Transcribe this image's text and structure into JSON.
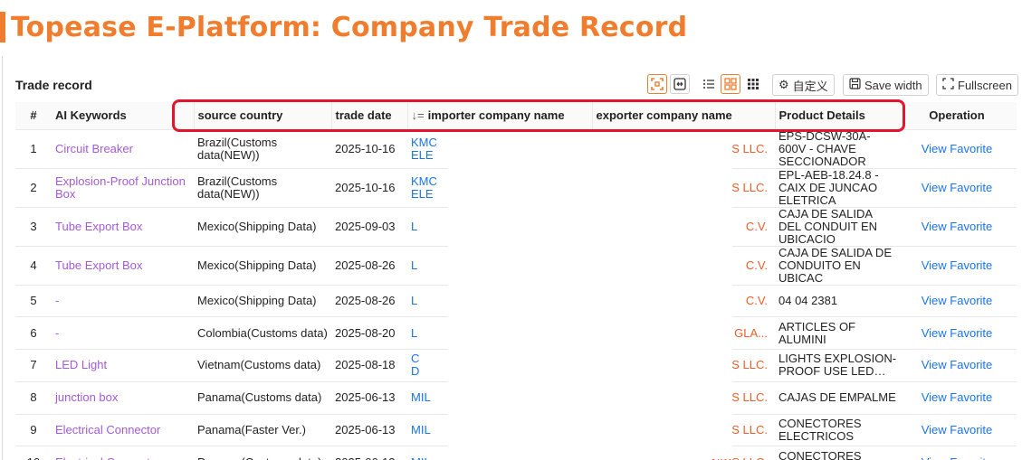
{
  "banner": {
    "title": "Topease E-Platform: Company Trade Record",
    "accent": "#ef7d2d"
  },
  "section": {
    "title": "Trade record"
  },
  "toolbar": {
    "icons": [
      "fit-screen-icon",
      "expand-width-icon",
      "list-view-icon",
      "grid-view-icon",
      "grid-dense-icon"
    ],
    "customize_label": "自定义",
    "save_width_label": "Save width",
    "fullscreen_label": "Fullscreen"
  },
  "table": {
    "headers": {
      "num": "#",
      "keywords": "AI Keywords",
      "country": "source country",
      "date": "trade date",
      "importer": "importer company name",
      "exporter": "exporter company name",
      "product": "Product Details",
      "operation": "Operation"
    },
    "rows": [
      {
        "num": "1",
        "keyword": "Circuit Breaker",
        "country": "Brazil(Customs data(NEW))",
        "date": "2025-10-16",
        "importer": "KMC",
        "importer2": "ELE",
        "exporter": "NICS LLC.",
        "product": "EPS-DCSW-30A-600V - CHAVE SECCIONADOR",
        "view": "View",
        "favorite": "Favorite"
      },
      {
        "num": "2",
        "keyword": "Explosion-Proof Junction Box",
        "country": "Brazil(Customs data(NEW))",
        "date": "2025-10-16",
        "importer": "KMC",
        "importer2": "ELE",
        "exporter": "NICS LLC.",
        "product": "EPL-AEB-18.24.8 - CAIX DE JUNCAO ELETRICA",
        "view": "View",
        "favorite": "Favorite"
      },
      {
        "num": "3",
        "keyword": "Tube Export Box",
        "country": "Mexico(Shipping Data)",
        "date": "2025-09-03",
        "importer": "L",
        "importer2": "",
        "exporter": "C.V.",
        "product": "CAJA DE SALIDA DEL CONDUIT EN UBICACIO",
        "view": "View",
        "favorite": "Favorite"
      },
      {
        "num": "4",
        "keyword": "Tube Export Box",
        "country": "Mexico(Shipping Data)",
        "date": "2025-08-26",
        "importer": "L",
        "importer2": "",
        "exporter": "C.V.",
        "product": "CAJA DE SALIDA DE CONDUITO EN UBICAC",
        "view": "View",
        "favorite": "Favorite"
      },
      {
        "num": "5",
        "keyword": "-",
        "country": "Mexico(Shipping Data)",
        "date": "2025-08-26",
        "importer": "L",
        "importer2": "",
        "exporter": "C.V.",
        "product": "04 04 2381",
        "view": "View",
        "favorite": "Favorite"
      },
      {
        "num": "6",
        "keyword": "-",
        "country": "Colombia(Customs data)",
        "date": "2025-08-20",
        "importer": "L",
        "importer2": "",
        "exporter": "ICAS GLA...",
        "product": "ARTICLES OF ALUMINI",
        "view": "View",
        "favorite": "Favorite"
      },
      {
        "num": "7",
        "keyword": "LED Light",
        "country": "Vietnam(Customs data)",
        "date": "2025-08-18",
        "importer": "C",
        "importer2": "D",
        "exporter": "NICS LLC.",
        "product": "LIGHTS EXPLOSION-PROOF USE LED…",
        "view": "View",
        "favorite": "Favorite"
      },
      {
        "num": "8",
        "keyword": "junction box",
        "country": "Panama(Customs data)",
        "date": "2025-06-13",
        "importer": "MIL",
        "importer2": "",
        "exporter": "NICS LLC.",
        "product": "CAJAS DE EMPALME",
        "view": "View",
        "favorite": "Favorite"
      },
      {
        "num": "9",
        "keyword": "Electrical Connector",
        "country": "Panama(Faster Ver.)",
        "date": "2025-06-13",
        "importer": "MIL",
        "importer2": "",
        "exporter": "NICS LLC.",
        "product": "CONECTORES ELECTRICOS",
        "view": "View",
        "favorite": "Favorite"
      },
      {
        "num": "10",
        "keyword": "Electrical Connector",
        "country": "Panama(Customs data)",
        "date": "2025-06-13",
        "importer": "MIL",
        "importer2": "",
        "exporter": "NICS LLC.",
        "product": "CONECTORES ELECTRICOS",
        "view": "View",
        "favorite": "Favorite"
      }
    ]
  },
  "colors": {
    "keyword": "#a45ad6",
    "link": "#1a73e8",
    "exporter": "#e85d2a",
    "highlight": "#e3142c"
  }
}
